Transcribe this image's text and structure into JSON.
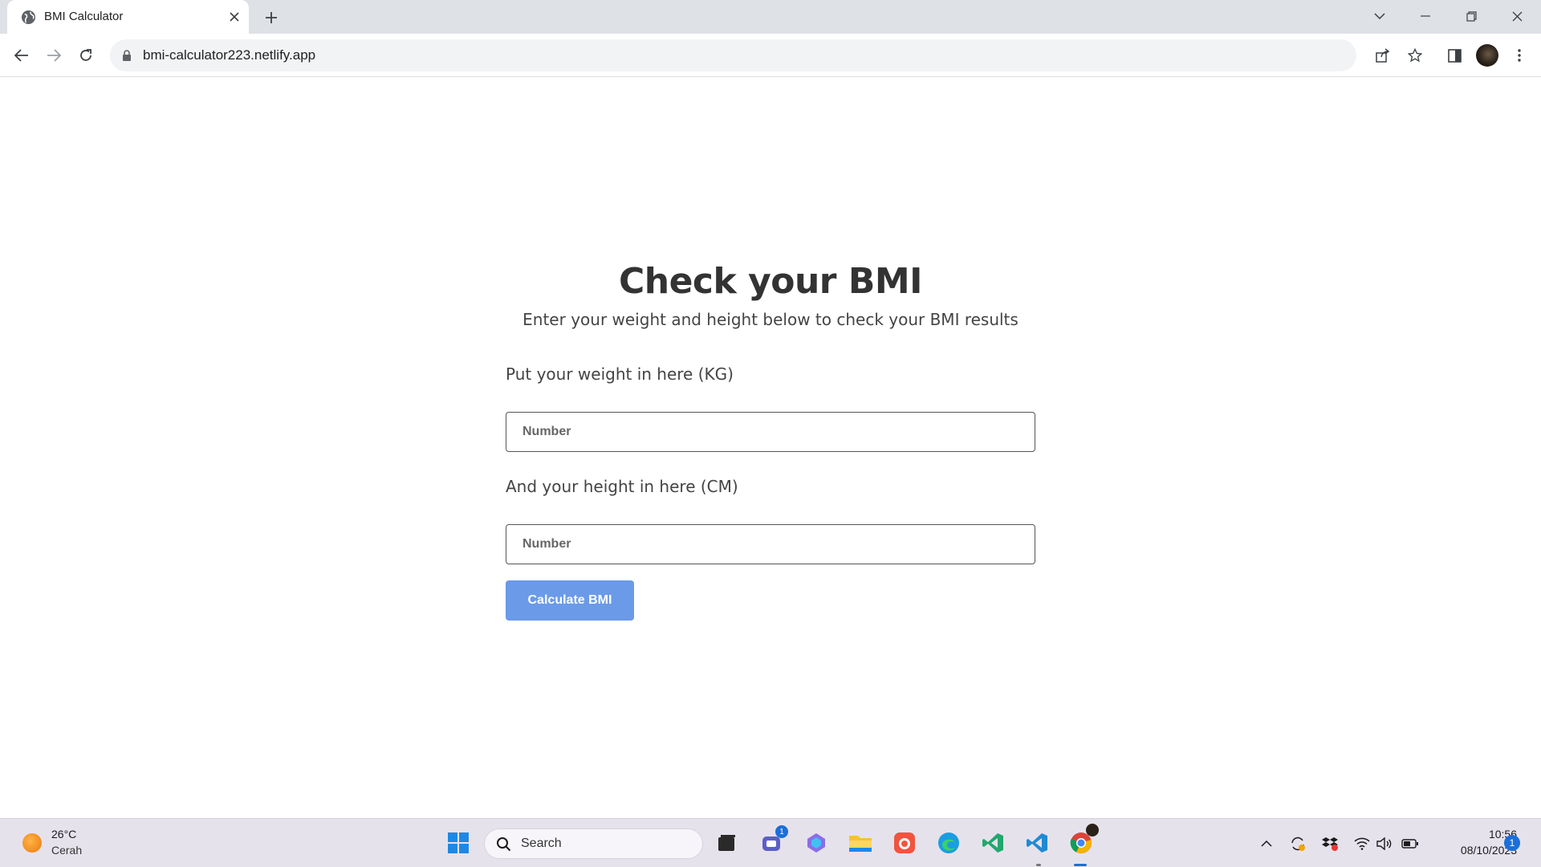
{
  "browser": {
    "tab_title": "BMI Calculator",
    "url": "bmi-calculator223.netlify.app"
  },
  "page": {
    "heading": "Check your BMI",
    "subheading": "Enter your weight and height below to check your BMI results",
    "weight_label": "Put your weight in here (KG)",
    "weight_placeholder": "Number",
    "weight_value": "",
    "height_label": "And your height in here (CM)",
    "height_placeholder": "Number",
    "height_value": "",
    "calculate_button": "Calculate BMI",
    "accent_color": "#6b9ae8"
  },
  "taskbar": {
    "weather_temp": "26°C",
    "weather_desc": "Cerah",
    "search_label": "Search",
    "teams_badge": "1",
    "clock_time": "10:56",
    "clock_date": "08/10/2023",
    "notification_count": "1",
    "apps": [
      "start-icon",
      "task-view-icon",
      "teams-icon",
      "copilot-icon",
      "file-explorer-icon",
      "app-icon",
      "edge-icon",
      "visual-studio-icon",
      "vscode-icon",
      "chrome-icon"
    ]
  }
}
